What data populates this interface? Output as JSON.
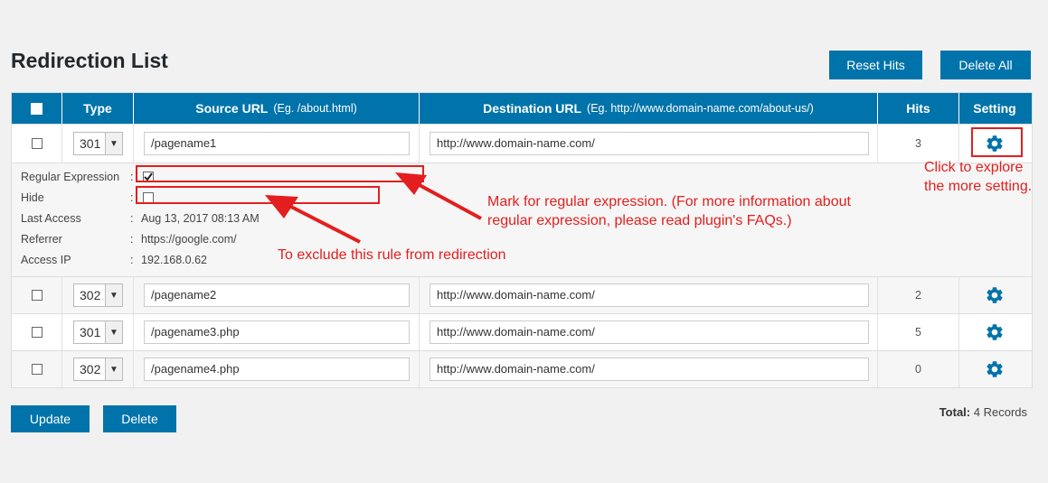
{
  "page": {
    "title": "Redirection List"
  },
  "toolbar": {
    "reset_hits_label": "Reset Hits",
    "delete_all_label": "Delete All"
  },
  "table": {
    "headers": {
      "type": "Type",
      "source": "Source URL",
      "source_hint": "(Eg. /about.html)",
      "destination": "Destination URL",
      "destination_hint": "(Eg. http://www.domain-name.com/about-us/)",
      "hits": "Hits",
      "setting": "Setting"
    },
    "rows": [
      {
        "type": "301",
        "source": "/pagename1",
        "destination": "http://www.domain-name.com/",
        "hits": "3"
      },
      {
        "type": "302",
        "source": "/pagename2",
        "destination": "http://www.domain-name.com/",
        "hits": "2"
      },
      {
        "type": "301",
        "source": "/pagename3.php",
        "destination": "http://www.domain-name.com/",
        "hits": "5"
      },
      {
        "type": "302",
        "source": "/pagename4.php",
        "destination": "http://www.domain-name.com/",
        "hits": "0"
      }
    ],
    "details": {
      "regex_label": "Regular Expression",
      "regex_checked": true,
      "hide_label": "Hide",
      "hide_checked": false,
      "last_access_label": "Last Access",
      "last_access_value": "Aug 13, 2017 08:13 AM",
      "referrer_label": "Referrer",
      "referrer_value": "https://google.com/",
      "access_ip_label": "Access IP",
      "access_ip_value": "192.168.0.62",
      "separator": ":"
    }
  },
  "footer": {
    "update_label": "Update",
    "delete_label": "Delete",
    "total_label": "Total:",
    "total_value": "4 Records"
  },
  "annotations": {
    "setting_note_line1": "Click to explore",
    "setting_note_line2": "the more setting.",
    "regex_note_line1": "Mark for regular expression. (For more information about",
    "regex_note_line2": "regular expression, please read plugin's FAQs.)",
    "hide_note": "To exclude this rule from redirection"
  },
  "icons": {
    "select_arrow": "chevron-down-icon",
    "setting": "gear-icon",
    "check": "checkmark-icon"
  },
  "colors": {
    "accent": "#0073aa",
    "annotation": "#e41e1e",
    "background": "#f1f1f1"
  }
}
